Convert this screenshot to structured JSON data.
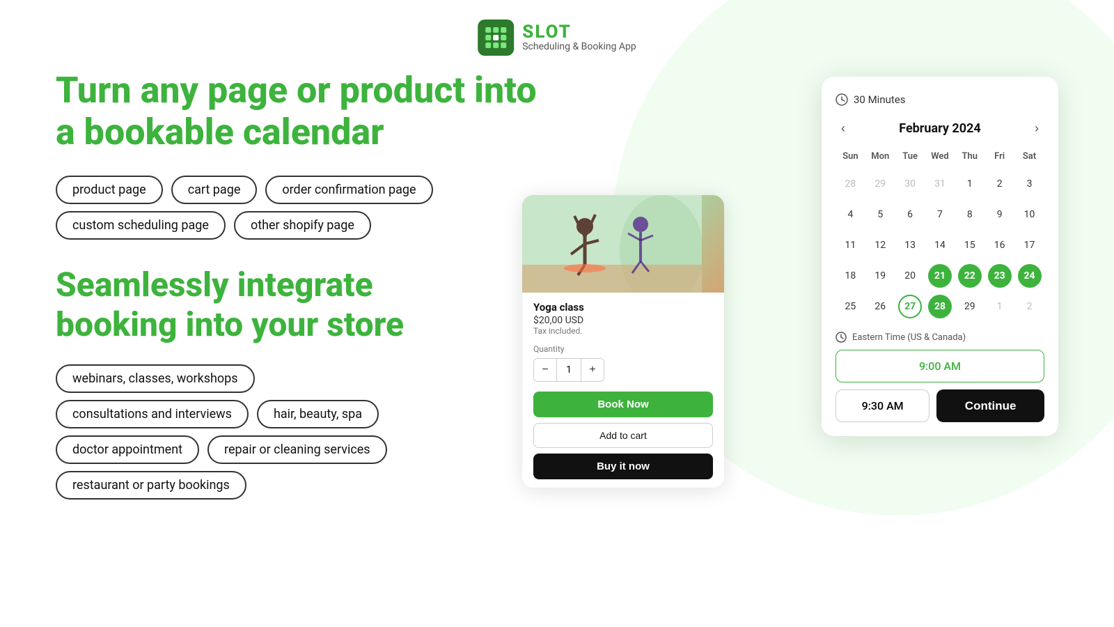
{
  "app": {
    "name": "SLOT",
    "subtitle": "Scheduling & Booking App"
  },
  "hero": {
    "headline_line1": "Turn any page or product into",
    "headline_line2": "a bookable calendar"
  },
  "page_tags": [
    "product page",
    "cart page",
    "order confirmation page",
    "custom scheduling page",
    "other shopify page"
  ],
  "integration": {
    "title_line1": "Seamlessly integrate",
    "title_line2": "booking into your store"
  },
  "use_case_tags": [
    "webinars, classes, workshops",
    "consultations and interviews",
    "hair, beauty, spa",
    "doctor appointment",
    "repair or cleaning services",
    "restaurant or party bookings"
  ],
  "product_card": {
    "name": "Yoga class",
    "price": "$20,00 USD",
    "tax": "Tax included.",
    "quantity_label": "Quantity",
    "quantity": "1",
    "qty_minus": "−",
    "qty_plus": "+",
    "book_now": "Book Now",
    "add_to_cart": "Add to cart",
    "buy_it_now": "Buy it now"
  },
  "calendar": {
    "duration": "30 Minutes",
    "month": "February 2024",
    "weekdays": [
      "Sun",
      "Mon",
      "Tue",
      "Wed",
      "Thu",
      "Fri",
      "Sat"
    ],
    "weeks": [
      [
        "28",
        "29",
        "30",
        "31",
        "1",
        "2",
        "3"
      ],
      [
        "4",
        "5",
        "6",
        "7",
        "8",
        "9",
        "10"
      ],
      [
        "11",
        "12",
        "13",
        "14",
        "15",
        "16",
        "17"
      ],
      [
        "18",
        "19",
        "20",
        "21",
        "22",
        "23",
        "24"
      ],
      [
        "25",
        "26",
        "27",
        "28",
        "29",
        "1",
        "2"
      ]
    ],
    "other_month_days": [
      "28",
      "29",
      "30",
      "31",
      "1",
      "2",
      "3",
      "1",
      "2"
    ],
    "green_fill_days": [
      "21",
      "22",
      "23",
      "24",
      "28"
    ],
    "green_outline_days": [
      "27"
    ],
    "timezone": "Eastern Time (US & Canada)",
    "time_slots": [
      "9:00 AM",
      "9:30 AM"
    ],
    "selected_slot": "9:00 AM",
    "continue_label": "Continue",
    "prev_nav": "‹",
    "next_nav": "›"
  }
}
